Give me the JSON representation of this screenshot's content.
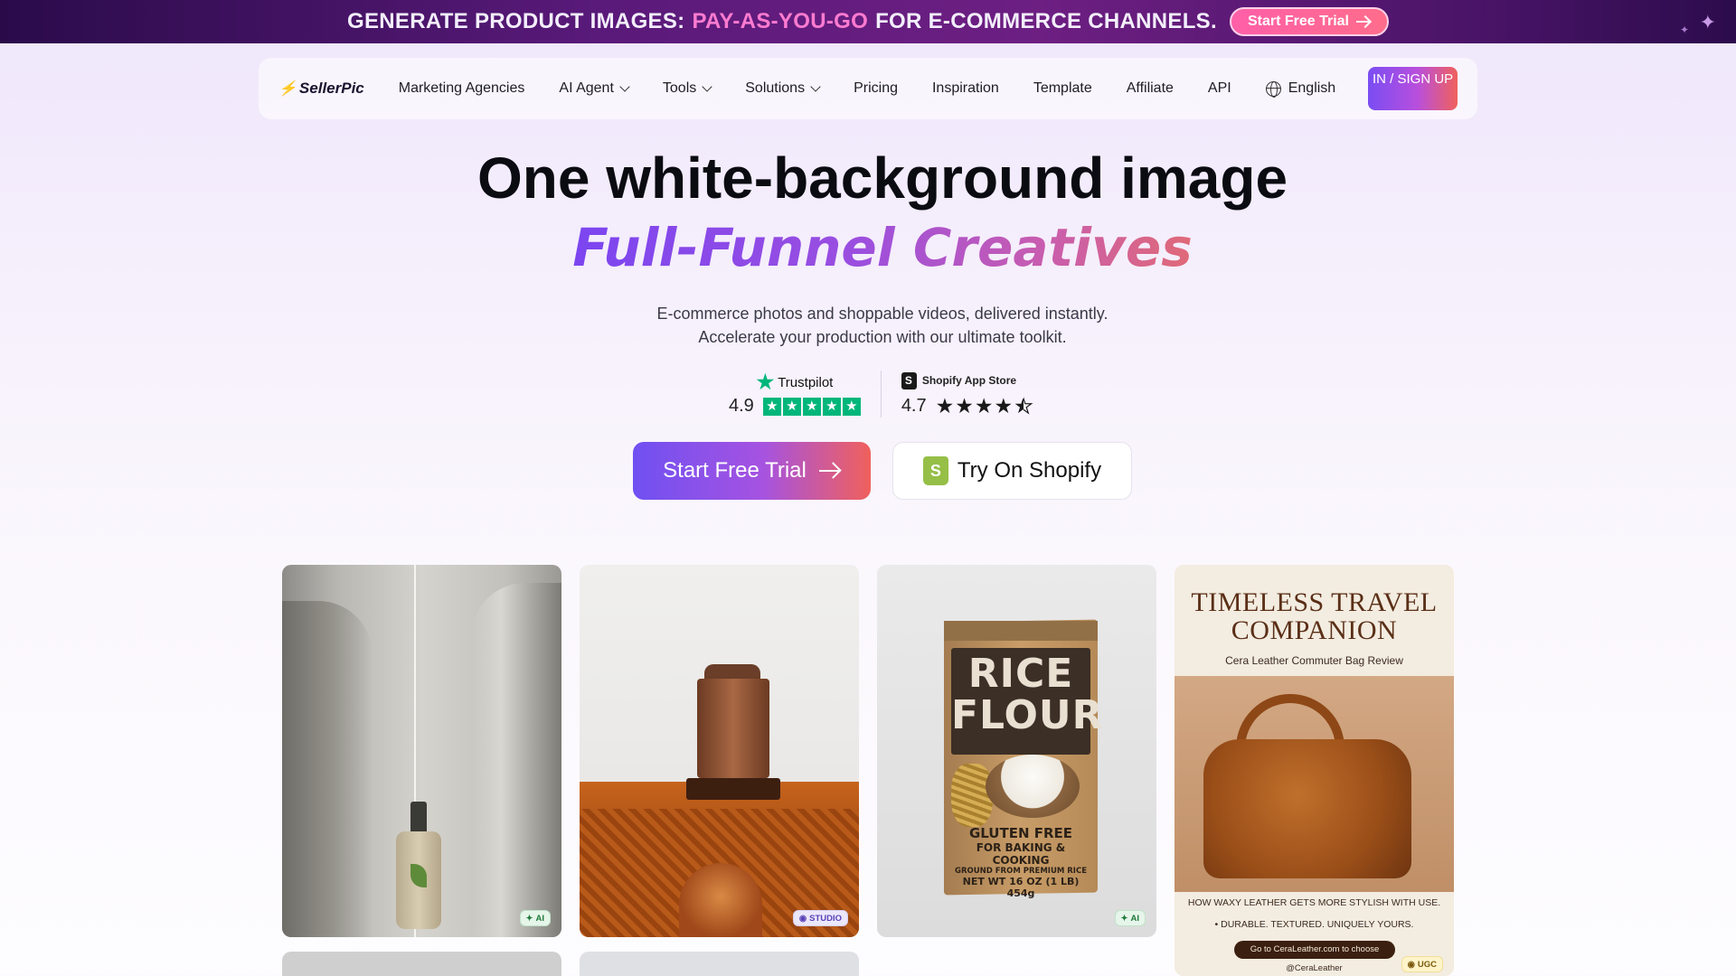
{
  "banner": {
    "text_a": "GENERATE PRODUCT IMAGES:",
    "text_b": "PAY-AS-YOU-GO",
    "text_c": "FOR E-COMMERCE CHANNELS.",
    "cta_label": "Start Free Trial"
  },
  "nav": {
    "logo": "SellerPic",
    "items": [
      {
        "label": "Marketing Agencies",
        "dropdown": false
      },
      {
        "label": "AI Agent",
        "dropdown": true
      },
      {
        "label": "Tools",
        "dropdown": true
      },
      {
        "label": "Solutions",
        "dropdown": true
      },
      {
        "label": "Pricing",
        "dropdown": false
      },
      {
        "label": "Inspiration",
        "dropdown": false
      },
      {
        "label": "Template",
        "dropdown": false
      },
      {
        "label": "Affiliate",
        "dropdown": false
      },
      {
        "label": "API",
        "dropdown": false
      }
    ],
    "language": "English",
    "auth_label": "IN / SIGN UP"
  },
  "hero": {
    "title": "One white-background image",
    "subtitle": "Full-Funnel Creatives",
    "desc_line1": "E-commerce photos and shoppable videos, delivered instantly.",
    "desc_line2": "Accelerate your production with our ultimate toolkit."
  },
  "ratings": {
    "trustpilot": {
      "name": "Trustpilot",
      "score": "4.9",
      "stars": 5
    },
    "shopify": {
      "name": "Shopify App Store",
      "score": "4.7",
      "stars": 4.5
    }
  },
  "ctas": {
    "primary": "Start Free Trial",
    "secondary": "Try On Shopify"
  },
  "gallery": [
    {
      "badge": "AI"
    },
    {
      "badge": "STUDIO"
    },
    {
      "badge": "AI",
      "bag_title": "RICE FLOUR",
      "bag_line1": "GLUTEN FREE",
      "bag_line2": "FOR BAKING & COOKING",
      "bag_line3": "GROUND FROM PREMIUM RICE",
      "bag_line4": "NET WT 16 OZ (1 LB) 454g"
    },
    {
      "badge": "UGC",
      "title": "TIMELESS TRAVEL COMPANION",
      "subtitle": "Cera Leather Commuter Bag Review",
      "note1": "HOW WAXY LEATHER GETS MORE STYLISH WITH USE.",
      "note2": "• DURABLE. TEXTURED. UNIQUELY YOURS.",
      "pill": "Go to CeraLeather.com to choose",
      "handle": "@CeraLeather"
    }
  ],
  "colors": {
    "accent_purple": "#7050f2",
    "accent_coral": "#f0615c",
    "trustpilot_green": "#00b67a",
    "shopify_green": "#95bf47"
  }
}
